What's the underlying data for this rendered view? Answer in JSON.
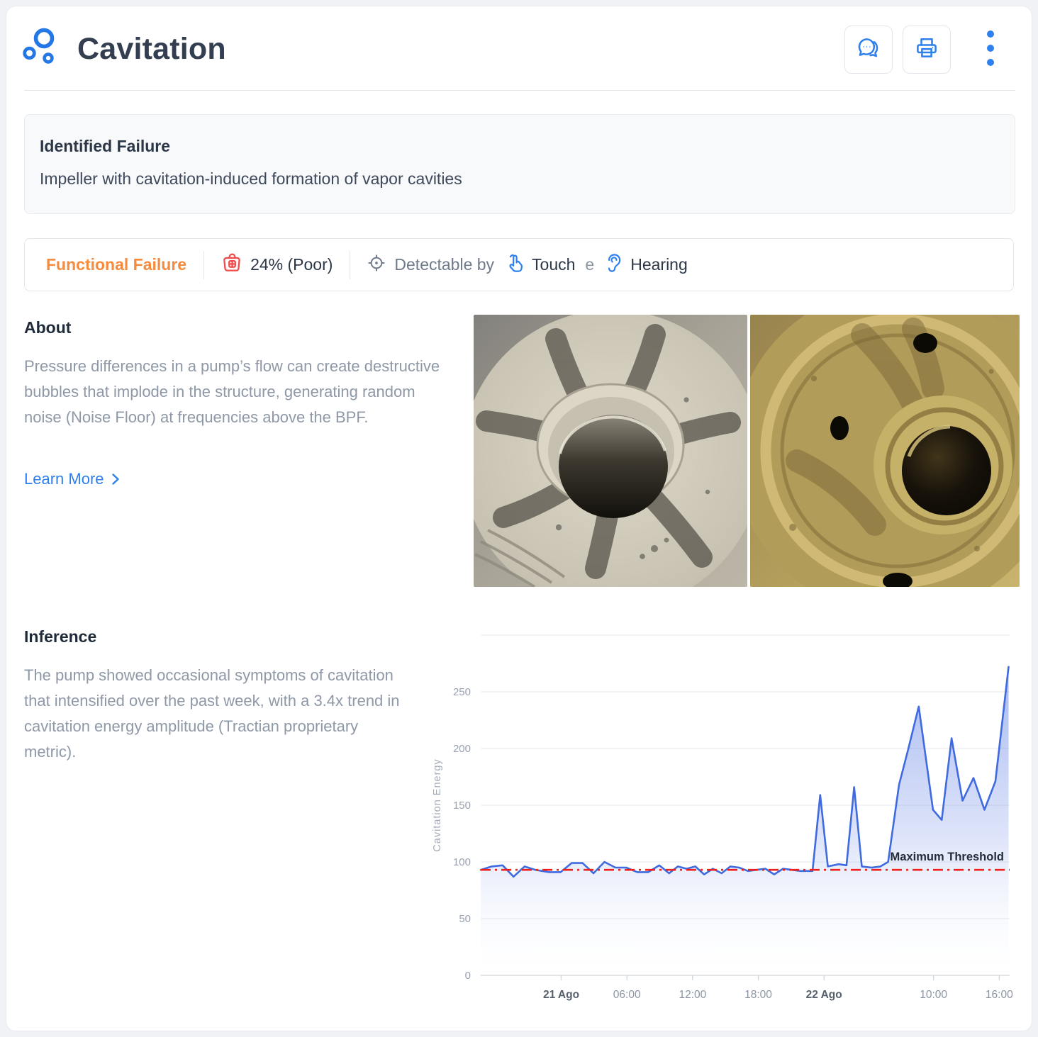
{
  "header": {
    "title": "Cavitation",
    "logo_icon": "cavitation-bubbles",
    "actions": [
      {
        "name": "chat",
        "icon": "chat-bubbles"
      },
      {
        "name": "print",
        "icon": "printer"
      },
      {
        "name": "more",
        "icon": "kebab-vertical"
      }
    ]
  },
  "identified_failure": {
    "title": "Identified Failure",
    "description": "Impeller with cavitation-induced formation of vapor cavities"
  },
  "status_bar": {
    "failure_type": "Functional Failure",
    "health_icon": "first-aid-bag",
    "health": "24% (Poor)",
    "detect_icon": "crosshair",
    "detectable_label": "Detectable by",
    "method_1_icon": "hand-tap",
    "method_1": "Touch",
    "conjunction": "e",
    "method_2_icon": "ear",
    "method_2": "Hearing"
  },
  "about": {
    "heading": "About",
    "body": "Pressure differences in a pump’s flow can create destructive bubbles that implode in the structure, generating random noise (Noise Floor) at frequencies above the BPF.",
    "learn_more_label": "Learn More",
    "images": [
      {
        "name": "impeller-photo-grey"
      },
      {
        "name": "impeller-photo-brass"
      }
    ]
  },
  "inference": {
    "heading": "Inference",
    "body": "The pump showed occasional symptoms of cavitation that intensified over the past week, with a 3.4x trend in cavitation energy amplitude (Tractian proprietary metric)."
  },
  "colors": {
    "accent_blue": "#2f80ed",
    "orange": "#f78b3d",
    "health_red": "#ee4d4d",
    "threshold_red": "#f0211c",
    "line_blue": "#3f6ae0",
    "text_dark": "#2b3647",
    "text_gray": "#8e98a7"
  },
  "chart_data": {
    "type": "area",
    "title": "",
    "xlabel": "",
    "ylabel": "Cavitation Energy",
    "ylim": [
      0,
      300
    ],
    "yticks": [
      0,
      50,
      100,
      150,
      200,
      250
    ],
    "grid": true,
    "legend_position": "none",
    "x_unit": "hours_from_window_start",
    "x_range": [
      0,
      48.3
    ],
    "xticks": [
      {
        "x": 7.35,
        "label": "21 Ago",
        "bold": true
      },
      {
        "x": 13.35,
        "label": "06:00",
        "bold": false
      },
      {
        "x": 19.35,
        "label": "12:00",
        "bold": false
      },
      {
        "x": 25.35,
        "label": "18:00",
        "bold": false
      },
      {
        "x": 31.35,
        "label": "22 Ago",
        "bold": true
      },
      {
        "x": 41.35,
        "label": "10:00",
        "bold": false
      },
      {
        "x": 47.35,
        "label": "16:00",
        "bold": false
      }
    ],
    "threshold": {
      "value": 93,
      "label": "Maximum Threshold"
    },
    "series": [
      {
        "name": "Cavitation Energy",
        "points": [
          [
            0,
            93
          ],
          [
            1,
            96
          ],
          [
            2,
            97
          ],
          [
            3,
            87
          ],
          [
            4,
            96
          ],
          [
            5,
            93
          ],
          [
            6.2,
            91
          ],
          [
            7.3,
            91
          ],
          [
            8.3,
            99
          ],
          [
            9.3,
            99
          ],
          [
            10.3,
            90
          ],
          [
            11.3,
            100
          ],
          [
            12.3,
            95
          ],
          [
            13.3,
            95
          ],
          [
            14.3,
            91
          ],
          [
            15.3,
            91
          ],
          [
            16.3,
            97
          ],
          [
            17.2,
            90
          ],
          [
            18,
            96
          ],
          [
            18.8,
            94
          ],
          [
            19.6,
            96
          ],
          [
            20.4,
            89
          ],
          [
            21.2,
            94
          ],
          [
            22,
            90
          ],
          [
            22.8,
            96
          ],
          [
            23.6,
            95
          ],
          [
            24.4,
            92
          ],
          [
            25.2,
            93
          ],
          [
            26,
            94
          ],
          [
            26.8,
            89
          ],
          [
            27.6,
            94
          ],
          [
            28.4,
            93
          ],
          [
            29.2,
            92
          ],
          [
            30.3,
            92
          ],
          [
            31,
            159
          ],
          [
            31.7,
            96
          ],
          [
            32.7,
            98
          ],
          [
            33.4,
            97
          ],
          [
            34.1,
            166
          ],
          [
            34.8,
            96
          ],
          [
            35.7,
            95
          ],
          [
            36.5,
            96
          ],
          [
            37.2,
            100
          ],
          [
            38.2,
            168
          ],
          [
            39,
            198
          ],
          [
            40,
            237
          ],
          [
            41.3,
            146
          ],
          [
            42.1,
            137
          ],
          [
            43,
            209
          ],
          [
            44,
            154
          ],
          [
            45,
            174
          ],
          [
            46,
            146
          ],
          [
            47,
            171
          ],
          [
            48.2,
            272
          ]
        ]
      }
    ]
  }
}
